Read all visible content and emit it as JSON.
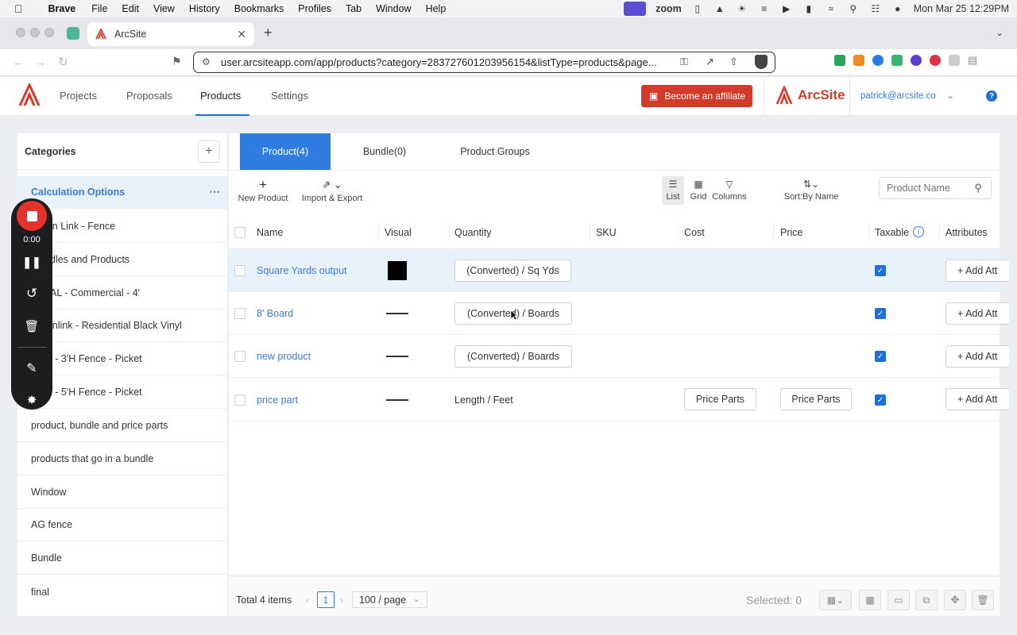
{
  "mac": {
    "app": "Brave",
    "menu": [
      "File",
      "Edit",
      "View",
      "History",
      "Bookmarks",
      "Profiles",
      "Tab",
      "Window",
      "Help"
    ],
    "zoom_label": "zoom",
    "clock": "Mon Mar 25  12:29PM"
  },
  "browser": {
    "tab_title": "ArcSite",
    "url": "user.arcsiteapp.com/app/products?category=283727601203956154&listType=products&page..."
  },
  "app": {
    "nav": [
      "Projects",
      "Proposals",
      "Products",
      "Settings"
    ],
    "active_nav": "Products",
    "affiliate_button": "Become an affiliate",
    "logo_text": "ArcSite",
    "user_email": "patrick@arcsite.co",
    "accent": "#1f6fd8",
    "brand_red": "#d23b2a"
  },
  "sidebar": {
    "title": "Categories",
    "items": [
      "Calculation Options",
      "Chain Link - Fence",
      "Bundles and Products",
      "AL - Commercial - 4'",
      "Chainlink - Residential Black Vinyl",
      "l - 3'H Fence - Picket",
      "l - 5'H Fence - Picket",
      "product, bundle and price parts",
      "products that go in a bundle",
      "Window",
      "AG fence",
      "Bundle",
      "final"
    ],
    "visible_items": [
      "Calculation Options",
      "in Link - Fence",
      "dles and Products",
      "AL - Commercial - 4'",
      "inlink - Residential Black Vinyl",
      "l - 3'H Fence - Picket",
      "l - 5'H Fence - Picket",
      "product, bundle and price parts",
      "products that go in a bundle",
      "Window",
      "AG fence",
      "Bundle",
      "final"
    ]
  },
  "tabs": [
    "Product(4)",
    "Bundle(0)",
    "Product Groups"
  ],
  "toolbar": {
    "new_product": "New Product",
    "import_export": "Import & Export",
    "list": "List",
    "grid": "Grid",
    "columns": "Columns",
    "sort": "Sort:By Name",
    "search_placeholder": "Product Name"
  },
  "table": {
    "headers": [
      "Name",
      "Visual",
      "Quantity",
      "SKU",
      "Cost",
      "Price",
      "Taxable",
      "Attributes"
    ],
    "rows": [
      {
        "name": "Square Yards output",
        "visual": "swatch",
        "quantity": "(Converted) / Sq Yds",
        "quantity_is_button": true,
        "cost": "",
        "price": "",
        "taxable": true,
        "attributes": "+ Add Att"
      },
      {
        "name": "8' Board",
        "visual": "line",
        "quantity": "(Converted) / Boards",
        "quantity_is_button": true,
        "cost": "",
        "price": "",
        "taxable": true,
        "attributes": "+ Add Att"
      },
      {
        "name": "new product",
        "visual": "line",
        "quantity": "(Converted) / Boards",
        "quantity_is_button": true,
        "cost": "",
        "price": "",
        "taxable": true,
        "attributes": "+ Add Att"
      },
      {
        "name": "price part",
        "visual": "line",
        "quantity": "Length / Feet",
        "quantity_is_button": false,
        "cost": "Price Parts",
        "price": "Price Parts",
        "taxable": true,
        "attributes": "+ Add Att"
      }
    ]
  },
  "footer": {
    "total": "Total 4 items",
    "page": "1",
    "per_page": "100 / page",
    "selected": "Selected: 0"
  },
  "recorder": {
    "time": "0:00"
  }
}
